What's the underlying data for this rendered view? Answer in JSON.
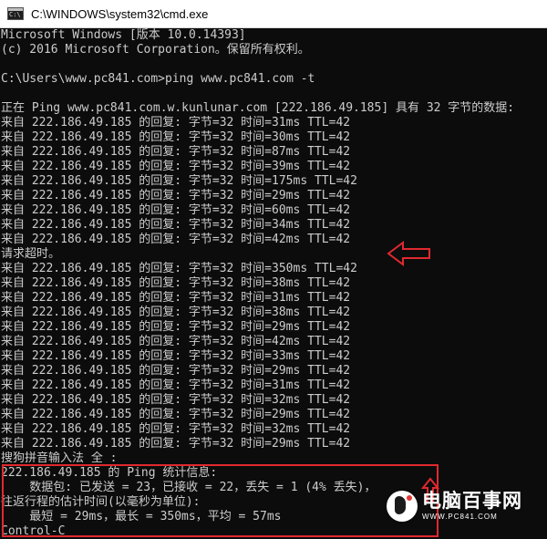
{
  "window": {
    "title": "C:\\WINDOWS\\system32\\cmd.exe"
  },
  "console": {
    "lines": [
      "Microsoft Windows [版本 10.0.14393]",
      "(c) 2016 Microsoft Corporation。保留所有权利。",
      "",
      "C:\\Users\\www.pc841.com>ping www.pc841.com -t",
      "",
      "正在 Ping www.pc841.com.w.kunlunar.com [222.186.49.185] 具有 32 字节的数据:",
      "来自 222.186.49.185 的回复: 字节=32 时间=31ms TTL=42",
      "来自 222.186.49.185 的回复: 字节=32 时间=30ms TTL=42",
      "来自 222.186.49.185 的回复: 字节=32 时间=87ms TTL=42",
      "来自 222.186.49.185 的回复: 字节=32 时间=39ms TTL=42",
      "来自 222.186.49.185 的回复: 字节=32 时间=175ms TTL=42",
      "来自 222.186.49.185 的回复: 字节=32 时间=29ms TTL=42",
      "来自 222.186.49.185 的回复: 字节=32 时间=60ms TTL=42",
      "来自 222.186.49.185 的回复: 字节=32 时间=34ms TTL=42",
      "来自 222.186.49.185 的回复: 字节=32 时间=42ms TTL=42",
      "请求超时。",
      "来自 222.186.49.185 的回复: 字节=32 时间=350ms TTL=42",
      "来自 222.186.49.185 的回复: 字节=32 时间=38ms TTL=42",
      "来自 222.186.49.185 的回复: 字节=32 时间=31ms TTL=42",
      "来自 222.186.49.185 的回复: 字节=32 时间=38ms TTL=42",
      "来自 222.186.49.185 的回复: 字节=32 时间=29ms TTL=42",
      "来自 222.186.49.185 的回复: 字节=32 时间=42ms TTL=42",
      "来自 222.186.49.185 的回复: 字节=32 时间=33ms TTL=42",
      "来自 222.186.49.185 的回复: 字节=32 时间=29ms TTL=42",
      "来自 222.186.49.185 的回复: 字节=32 时间=31ms TTL=42",
      "来自 222.186.49.185 的回复: 字节=32 时间=32ms TTL=42",
      "来自 222.186.49.185 的回复: 字节=32 时间=29ms TTL=42",
      "来自 222.186.49.185 的回复: 字节=32 时间=32ms TTL=42",
      "来自 222.186.49.185 的回复: 字节=32 时间=29ms TTL=42",
      "搜狗拼音输入法 全 :",
      "222.186.49.185 的 Ping 统计信息:",
      "    数据包: 已发送 = 23，已接收 = 22，丢失 = 1 (4% 丢失)，",
      "往返行程的估计时间(以毫秒为单位):",
      "    最短 = 29ms，最长 = 350ms，平均 = 57ms",
      "Control-C"
    ]
  },
  "watermark": {
    "name": "电脑百事网",
    "url": "WWW.PC841.COM"
  },
  "colors": {
    "console_text": "#cccccc",
    "console_bg": "#0c0c0c",
    "annotation_red": "#e0292f"
  }
}
